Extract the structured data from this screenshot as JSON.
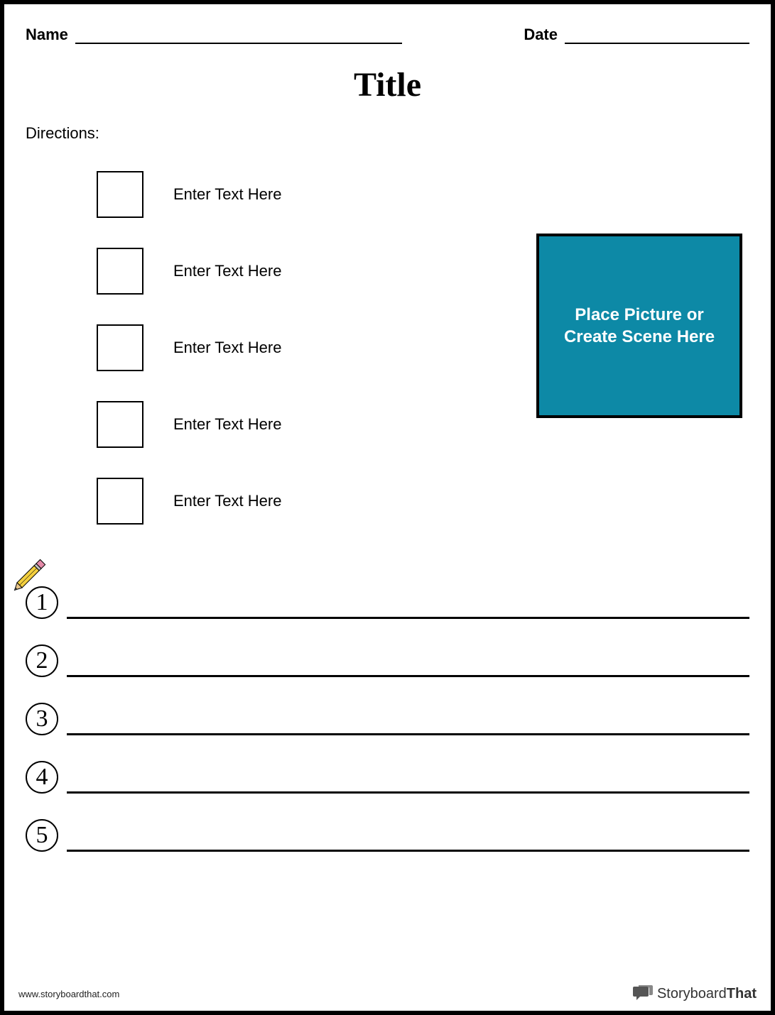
{
  "header": {
    "name_label": "Name",
    "date_label": "Date"
  },
  "title": "Title",
  "directions_label": "Directions:",
  "checklist": [
    {
      "text": "Enter Text Here"
    },
    {
      "text": "Enter Text Here"
    },
    {
      "text": "Enter Text Here"
    },
    {
      "text": "Enter Text Here"
    },
    {
      "text": "Enter Text Here"
    }
  ],
  "picture_placeholder": "Place Picture or Create Scene Here",
  "numbered_lines": [
    "1",
    "2",
    "3",
    "4",
    "5"
  ],
  "footer": {
    "url": "www.storyboardthat.com",
    "brand_prefix": "Storyboard",
    "brand_suffix": "That"
  }
}
